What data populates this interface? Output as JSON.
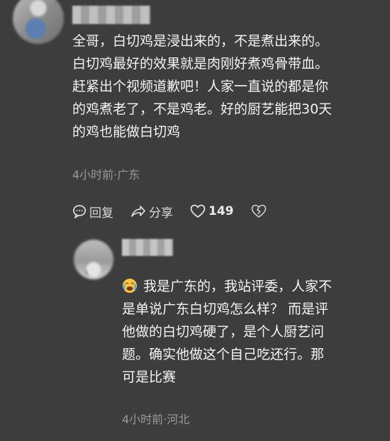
{
  "main_comment": {
    "lines": [
      "全哥，白切鸡是浸出来的，不是煮出来的。",
      "白切鸡最好的效果就是肉刚好煮鸡骨带血。",
      "赶紧出个视频道歉吧！人家一直说的都是你",
      "的鸡煮老了，不是鸡老。好的厨艺能把30天",
      "的鸡也能做白切鸡"
    ],
    "meta": "4小时前·广东",
    "actions": {
      "reply_label": "回复",
      "share_label": "分享",
      "like_count": "149"
    }
  },
  "reply": {
    "emoji_icon": "crying-face-icon",
    "lines": [
      "我是广东的，我站评委，人家不",
      "是单说广东白切鸡怎么样？ 而是评",
      "他做的白切鸡硬了，是个人厨艺问",
      "题。确实他做这个自己吃还行。那",
      "可是比赛"
    ],
    "meta": "4小时前·河北"
  }
}
